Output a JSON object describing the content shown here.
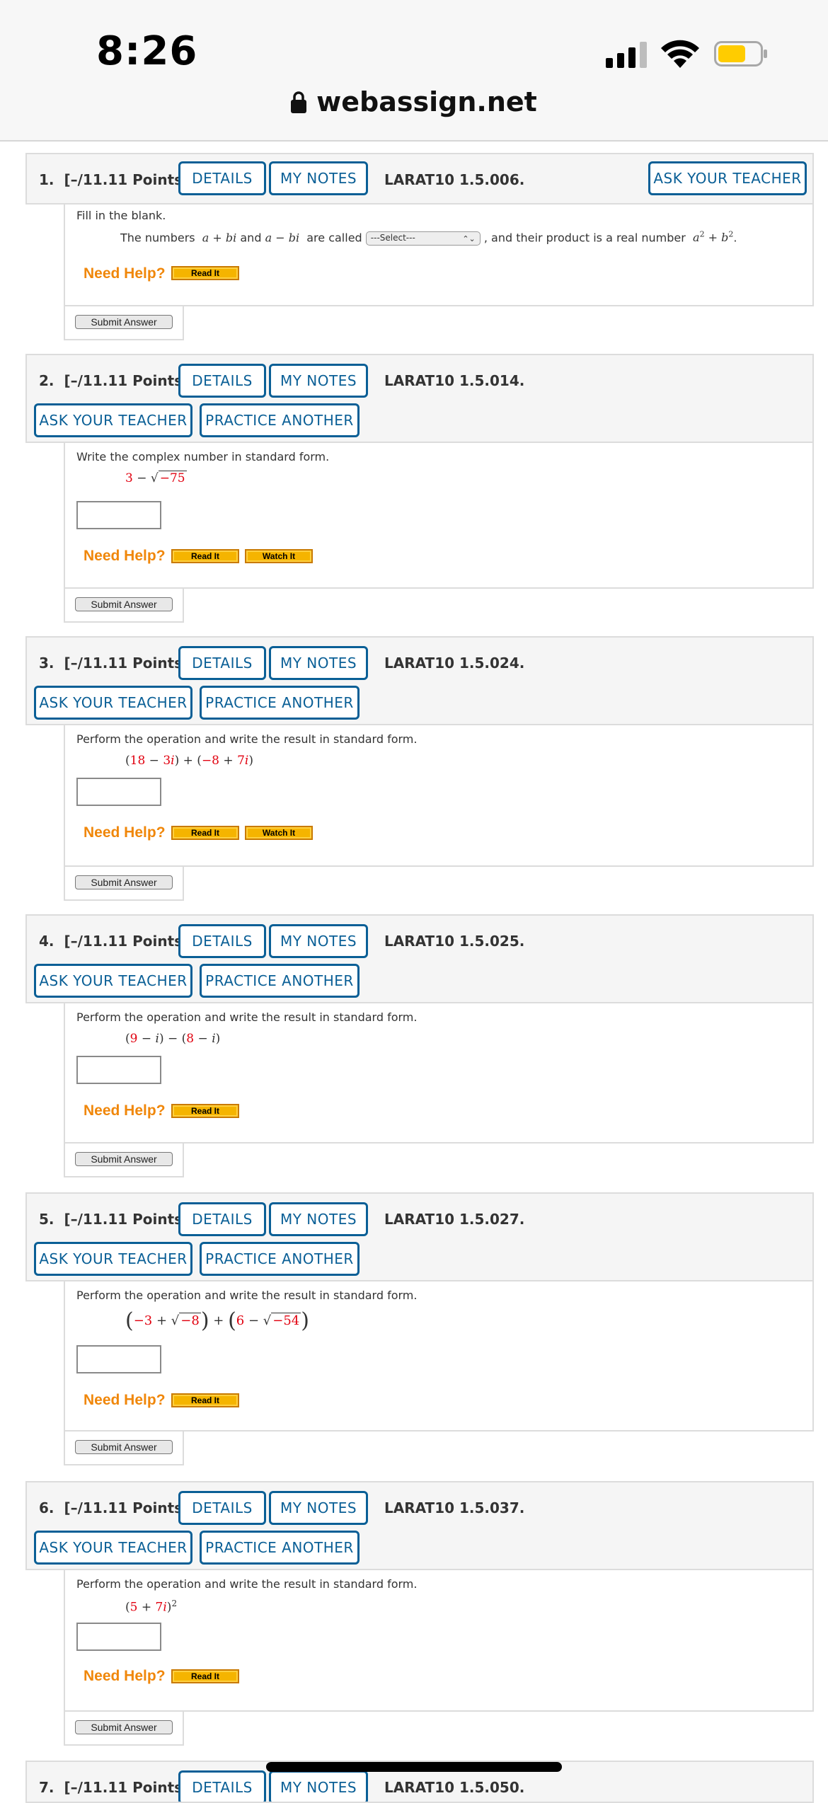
{
  "status_bar": {
    "time": "8:26",
    "url": "webassign.net"
  },
  "buttons": {
    "details": "DETAILS",
    "my_notes": "MY NOTES",
    "ask_teacher": "ASK YOUR TEACHER",
    "practice_another": "PRACTICE ANOTHER",
    "read_it": "Read It",
    "watch_it": "Watch It",
    "submit": "Submit Answer",
    "need_help": "Need Help?"
  },
  "questions": [
    {
      "num": "1.",
      "points": "[–/11.11 Points]",
      "id": "LARAT10 1.5.006.",
      "prompt": "Fill in the blank.",
      "text_before": "The numbers",
      "text_mid": "and",
      "text_called": "are called",
      "select_placeholder": "---Select---",
      "text_after": ", and their product is a real number"
    },
    {
      "num": "2.",
      "points": "[–/11.11 Points]",
      "id": "LARAT10 1.5.014.",
      "prompt": "Write the complex number in standard form."
    },
    {
      "num": "3.",
      "points": "[–/11.11 Points]",
      "id": "LARAT10 1.5.024.",
      "prompt": "Perform the operation and write the result in standard form."
    },
    {
      "num": "4.",
      "points": "[–/11.11 Points]",
      "id": "LARAT10 1.5.025.",
      "prompt": "Perform the operation and write the result in standard form."
    },
    {
      "num": "5.",
      "points": "[–/11.11 Points]",
      "id": "LARAT10 1.5.027.",
      "prompt": "Perform the operation and write the result in standard form."
    },
    {
      "num": "6.",
      "points": "[–/11.11 Points]",
      "id": "LARAT10 1.5.037.",
      "prompt": "Perform the operation and write the result in standard form."
    },
    {
      "num": "7.",
      "points": "[–/11.11 Points]",
      "id": "LARAT10 1.5.050."
    }
  ],
  "colors": {
    "accent": "#0a5f96",
    "help_orange": "#f0870a",
    "math_red": "#e1000f",
    "help_button": "#f5b400"
  }
}
